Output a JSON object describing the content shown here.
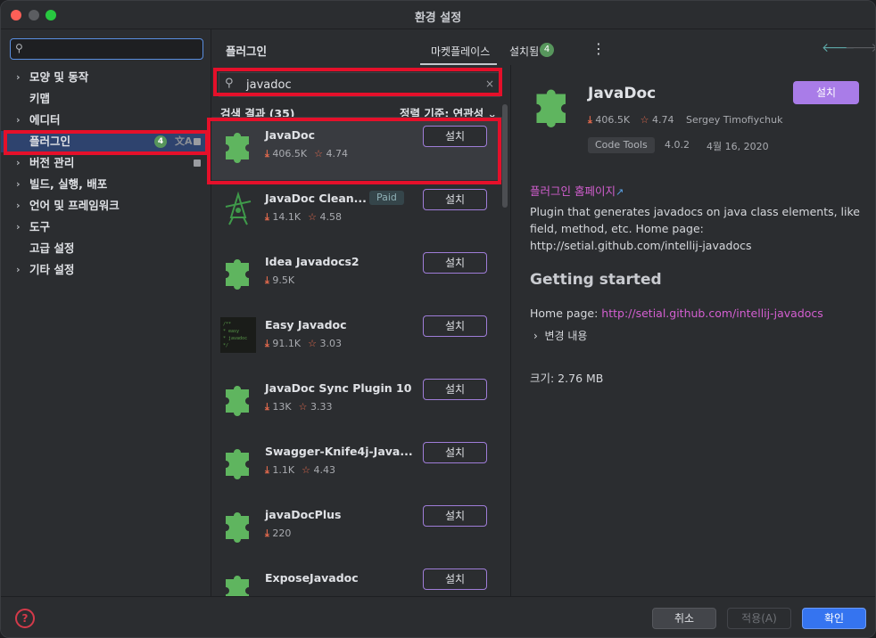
{
  "window": {
    "title": "환경 설정"
  },
  "sidebar": {
    "search_placeholder": "",
    "items": [
      {
        "label": "모양 및 동작",
        "chevron": true
      },
      {
        "label": "키맵",
        "chevron": false
      },
      {
        "label": "에디터",
        "chevron": true
      },
      {
        "label": "플러그인",
        "chevron": false,
        "selected": true,
        "badge": "4"
      },
      {
        "label": "버전 관리",
        "chevron": true
      },
      {
        "label": "빌드, 실행, 배포",
        "chevron": true
      },
      {
        "label": "언어 및 프레임워크",
        "chevron": true
      },
      {
        "label": "도구",
        "chevron": true
      },
      {
        "label": "고급 설정",
        "chevron": false
      },
      {
        "label": "기타 설정",
        "chevron": true
      }
    ]
  },
  "header": {
    "title": "플러그인",
    "tab_marketplace": "마켓플레이스",
    "tab_installed": "설치됨",
    "installed_badge": "4",
    "kebab": "⋮",
    "back": "🡐",
    "forward": "🡒"
  },
  "search": {
    "value": "javadoc",
    "clear": "×"
  },
  "results": {
    "count_label": "검색 결과 (35)",
    "sort_label": "정렬 기준: 연관성 ⌄",
    "install_label": "설치",
    "paid_label": "Paid",
    "plugins": [
      {
        "name": "JavaDoc",
        "downloads": "406.5K",
        "rating": "4.74",
        "icon": "puzzle"
      },
      {
        "name": "JavaDoc Clean...",
        "downloads": "14.1K",
        "rating": "4.58",
        "paid": true,
        "icon": "wizard"
      },
      {
        "name": "Idea Javadocs2",
        "downloads": "9.5K",
        "rating": "",
        "icon": "puzzle"
      },
      {
        "name": "Easy Javadoc",
        "downloads": "91.1K",
        "rating": "3.03",
        "icon": "code-thumb"
      },
      {
        "name": "JavaDoc Sync Plugin 10",
        "downloads": "13K",
        "rating": "3.33",
        "icon": "puzzle"
      },
      {
        "name": "Swagger-Knife4j-Java...",
        "downloads": "1.1K",
        "rating": "4.43",
        "icon": "puzzle"
      },
      {
        "name": "javaDocPlus",
        "downloads": "220",
        "rating": "",
        "icon": "puzzle"
      },
      {
        "name": "ExposeJavadoc",
        "downloads": "",
        "rating": "",
        "icon": "puzzle"
      }
    ]
  },
  "detail": {
    "name": "JavaDoc",
    "install_label": "설치",
    "downloads": "406.5K",
    "rating": "4.74",
    "author": "Sergey Timofiychuk",
    "tag": "Code Tools",
    "version": "4.0.2",
    "date": "4월 16, 2020",
    "homepage_label": "플러그인 홈페이지",
    "description": "Plugin that generates javadocs on java class elements, like field, method, etc. Home page: http://setial.github.com/intellij-javadocs",
    "section_title": "Getting started",
    "home_page_prefix": "Home page: ",
    "home_page_url": "http://setial.github.com/intellij-javadocs",
    "changes_label": "변경 내용",
    "size_label": "크기: 2.76 MB"
  },
  "footer": {
    "help": "?",
    "cancel": "취소",
    "apply": "적용(A)",
    "ok": "확인"
  },
  "colors": {
    "accent_purple": "#a97ce8",
    "highlight_red": "#e5102a",
    "primary_blue": "#3574f0",
    "plugin_green": "#5fb55f"
  }
}
